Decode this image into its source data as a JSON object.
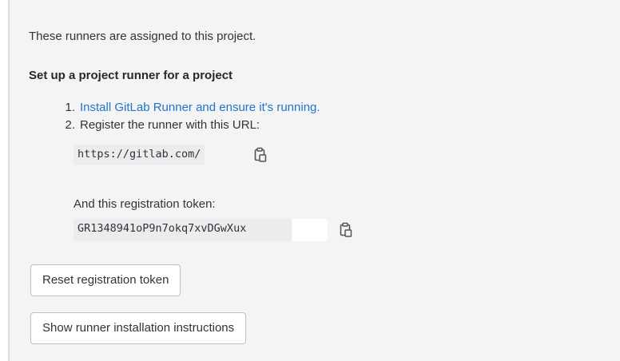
{
  "intro_text": "These runners are assigned to this project.",
  "heading": "Set up a project runner for a project",
  "steps": [
    {
      "number": "1.",
      "text": "Install GitLab Runner and ensure it's running."
    },
    {
      "number": "2.",
      "text": "Register the runner with this URL:"
    }
  ],
  "runner_url": "https://gitlab.com/",
  "token_label": "And this registration token:",
  "registration_token": "GR1348941oP9n7okq7xvDGwXux",
  "buttons": {
    "reset_token": "Reset registration token",
    "show_instructions": "Show runner installation instructions"
  },
  "icons": {
    "copy": "clipboard-icon"
  },
  "colors": {
    "link": "#1f75cb",
    "panel_background": "#f4f4f5"
  }
}
